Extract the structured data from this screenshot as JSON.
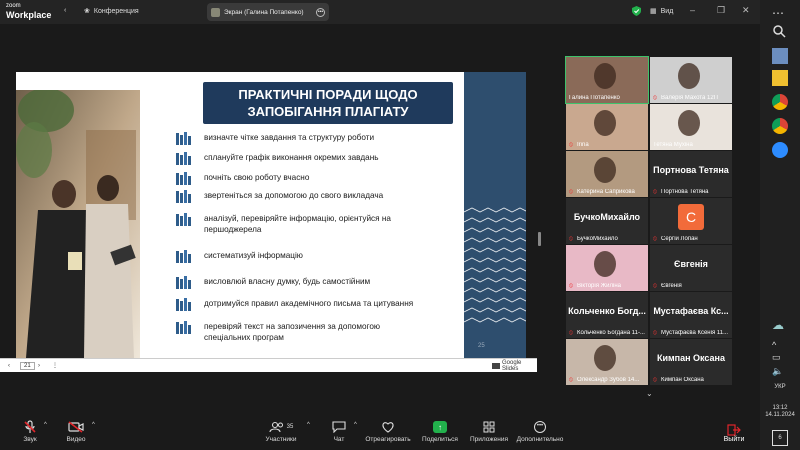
{
  "topbar": {
    "logo_top": "zoom",
    "logo_bottom": "Workplace",
    "conference_label": "Конференция",
    "screen_label": "Экран (Галина Потапенко)",
    "view_label": "Вид"
  },
  "slide": {
    "title_line1": "ПРАКТИЧНІ ПОРАДИ ЩОДО",
    "title_line2": "ЗАПОБІГАННЯ ПЛАГІАТУ",
    "bullets": [
      "визначте чітке завдання та структуру роботи",
      "сплануйте графік виконання окремих завдань",
      "почніть свою роботу вчасно",
      "звертеніться за допомогою до свого викладача",
      "аналізуй, перевіряйте інформацію, орієнтуйся на першоджерела",
      "систематизуй інформацію",
      "висловлюй власну думку, будь самостійним",
      "дотримуйся правил академічного письма та цитування",
      "перевіряй текст на запозичення за допомогою спеціальних програм"
    ],
    "page_number": "25",
    "nav_page": "21",
    "provider": "Google Slides"
  },
  "gallery": [
    {
      "name": "Галина Потапенко",
      "big": "",
      "muted": false,
      "kind": "video"
    },
    {
      "name": "Валерія Махота 12П",
      "big": "",
      "muted": true,
      "kind": "video"
    },
    {
      "name": "Irina",
      "big": "",
      "muted": true,
      "kind": "video"
    },
    {
      "name": "Тетяна Мухіна",
      "big": "",
      "muted": false,
      "kind": "video"
    },
    {
      "name": "Катерина Саприкова",
      "big": "",
      "muted": true,
      "kind": "video"
    },
    {
      "name": "Портнова Тетяна",
      "big": "Портнова Тетяна",
      "muted": true,
      "kind": "name"
    },
    {
      "name": "БучкоМихайло",
      "big": "БучкоМихайло",
      "muted": true,
      "kind": "name"
    },
    {
      "name": "Сергій Лопан",
      "big": "C",
      "muted": true,
      "kind": "avatar"
    },
    {
      "name": "Вікторія Жиліна",
      "big": "",
      "muted": true,
      "kind": "video"
    },
    {
      "name": "Євгенія",
      "big": "Євгенія",
      "muted": true,
      "kind": "name"
    },
    {
      "name": "Кольченко Богдана 11-...",
      "big": "Кольченко Богд...",
      "muted": true,
      "kind": "name"
    },
    {
      "name": "Мустафаєва Ксенія 11...",
      "big": "Мустафаєва Кс...",
      "muted": true,
      "kind": "name"
    },
    {
      "name": "Олександр Зубов 14...",
      "big": "",
      "muted": true,
      "kind": "video"
    },
    {
      "name": "Кимпан Оксана",
      "big": "Кимпан Оксана",
      "muted": true,
      "kind": "name"
    }
  ],
  "toolbar": {
    "sound": "Звук",
    "video": "Видео",
    "participants": "Участники",
    "participants_count": "35",
    "chat": "Чат",
    "react": "Отреагировать",
    "share": "Поделиться",
    "apps": "Приложения",
    "more": "Дополнительно",
    "leave": "Выйти"
  },
  "taskbar": {
    "lang": "УКР",
    "time": "13:12",
    "date": "14.11.2024",
    "notif": "6"
  },
  "colors": {
    "title_bg": "#1f3a5c",
    "share_green": "#22b14c",
    "leave_red": "#e0262b"
  }
}
